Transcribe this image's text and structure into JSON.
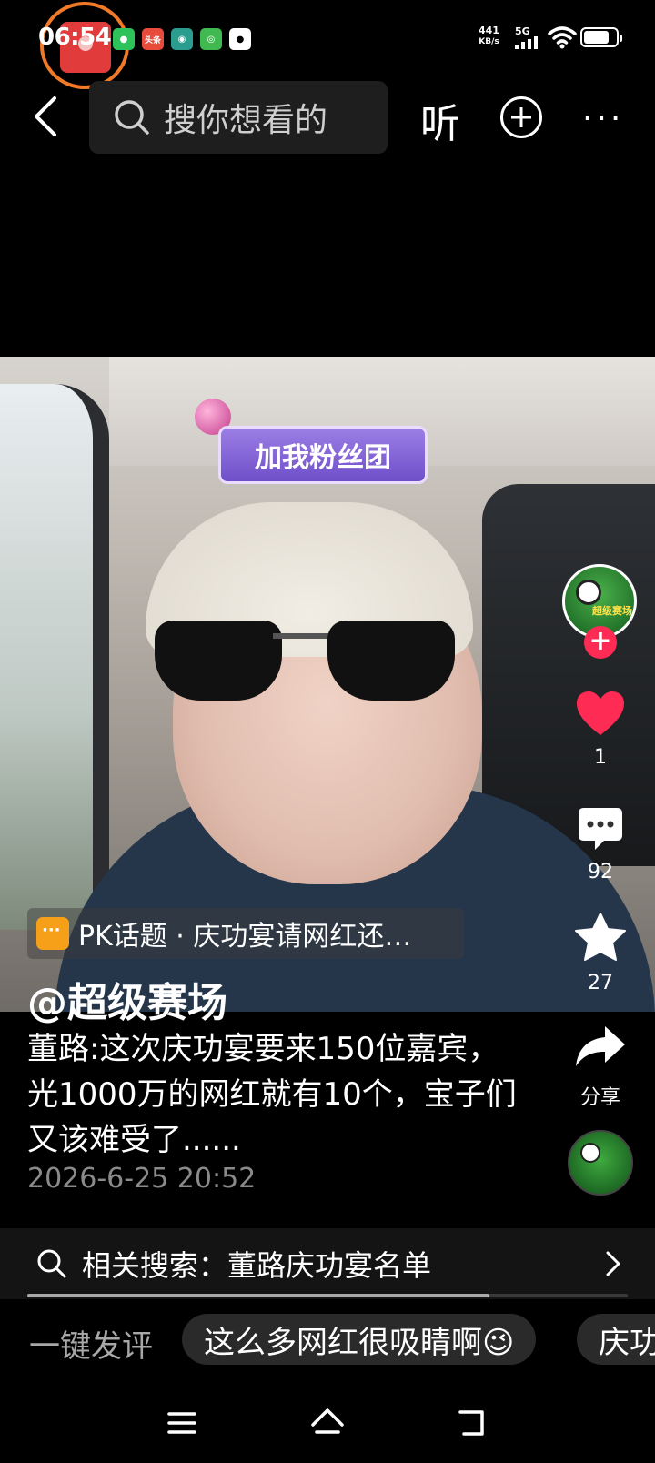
{
  "status_bar": {
    "time": "06:54",
    "net_speed_value": "441",
    "net_speed_unit": "KB/s",
    "network": "5G",
    "notification_apps": [
      "wechat-icon",
      "toutiao-icon",
      "app-icon",
      "app-icon",
      "qq-icon"
    ],
    "toutiao_label": "头条"
  },
  "top_nav": {
    "search_placeholder": "搜你想看的",
    "listen_label": "听",
    "more_label": "···"
  },
  "video": {
    "sticker_text": "加我粉丝团"
  },
  "actions": {
    "avatar_text": "超级赛场",
    "likes": "1",
    "comments": "92",
    "favorites": "27",
    "share_label": "分享",
    "accent_color": "#fe2c55"
  },
  "caption": {
    "topic": "PK话题 · 庆功宴请网红还…",
    "author": "@超级赛场",
    "description": "董路:这次庆功宴要来150位嘉宾，光1000万的网红就有10个，宝子们又该难受了......",
    "timestamp": "2026-6-25 20:52"
  },
  "related_search": {
    "label": "相关搜索：董路庆功宴名单",
    "progress": 0.77
  },
  "quick_comment": {
    "label": "一键发评",
    "chips": [
      "这么多网红很吸睛啊😉",
      "庆功"
    ]
  }
}
